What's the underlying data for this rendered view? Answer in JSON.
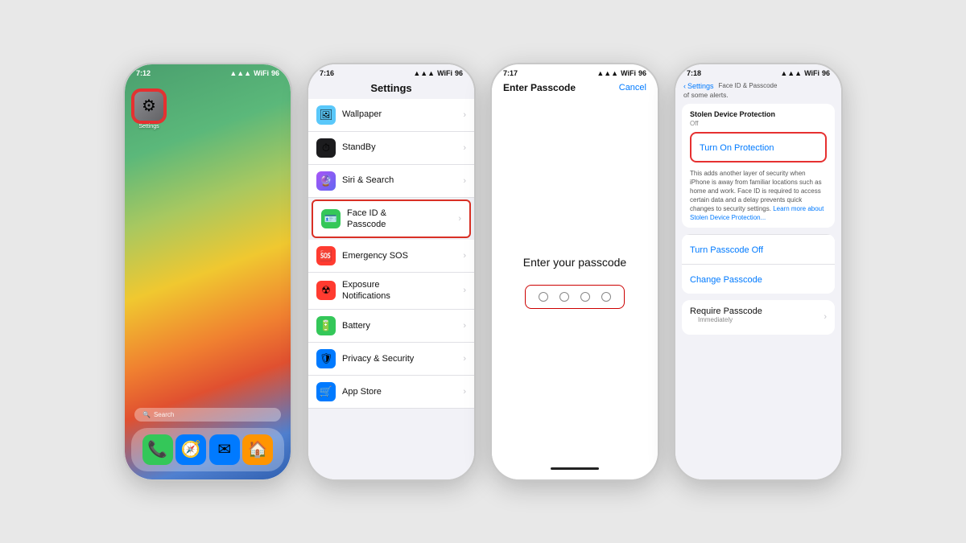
{
  "phone1": {
    "statusBar": {
      "time": "7:12",
      "signal": "●●●●",
      "wifi": "WiFi",
      "battery": "96"
    },
    "appIcon": {
      "label": "Settings",
      "symbol": "⚙"
    },
    "searchBar": {
      "icon": "🔍",
      "placeholder": "Search"
    },
    "dockApps": [
      "📞",
      "🧭",
      "✉",
      "🏠"
    ]
  },
  "phone2": {
    "statusBar": {
      "time": "7:16",
      "battery": "96"
    },
    "navTitle": "Settings",
    "items": [
      {
        "icon": "🖼",
        "iconBg": "#5ac8fa",
        "label": "Wallpaper",
        "highlighted": false
      },
      {
        "icon": "⏱",
        "iconBg": "#1c1c1e",
        "label": "StandBy",
        "highlighted": false
      },
      {
        "icon": "🔮",
        "iconBg": "#a855f7",
        "label": "Siri & Search",
        "highlighted": false
      },
      {
        "icon": "🪪",
        "iconBg": "#34c759",
        "label": "Face ID &\nPasscode",
        "highlighted": true
      },
      {
        "icon": "🆘",
        "iconBg": "#ff3b30",
        "label": "Emergency SOS",
        "highlighted": false
      },
      {
        "icon": "☢",
        "iconBg": "#ff3b30",
        "label": "Exposure\nNotifications",
        "highlighted": false
      },
      {
        "icon": "🔋",
        "iconBg": "#34c759",
        "label": "Battery",
        "highlighted": false
      },
      {
        "icon": "🛡",
        "iconBg": "#007aff",
        "label": "Privacy & Security",
        "highlighted": false
      },
      {
        "icon": "🛒",
        "iconBg": "#007aff",
        "label": "App Store",
        "highlighted": false
      }
    ]
  },
  "phone3": {
    "statusBar": {
      "time": "7:17",
      "battery": "96"
    },
    "navTitle": "Enter Passcode",
    "cancelLabel": "Cancel",
    "prompt": "Enter your passcode",
    "dots": 4
  },
  "phone4": {
    "statusBar": {
      "time": "7:18",
      "battery": "96"
    },
    "breadcrumb": "Settings",
    "navTitle": "Face ID & Passcode",
    "subtitle": "of some alerts.",
    "stolenProtectionTitle": "Stolen Device Protection",
    "stolenProtectionStatus": "Off",
    "turnOnLabel": "Turn On Protection",
    "descriptionText": "This adds another layer of security when iPhone is away from familiar locations such as home and work. Face ID is required to access certain data and a delay prevents quick changes to security settings.",
    "learnMoreText": "Learn more about Stolen Device Protection...",
    "turnPasscodeOffLabel": "Turn Passcode Off",
    "changePasscodeLabel": "Change Passcode",
    "requirePasscodeLabel": "Require Passcode",
    "requirePasscodeSubLabel": "Immediately"
  }
}
